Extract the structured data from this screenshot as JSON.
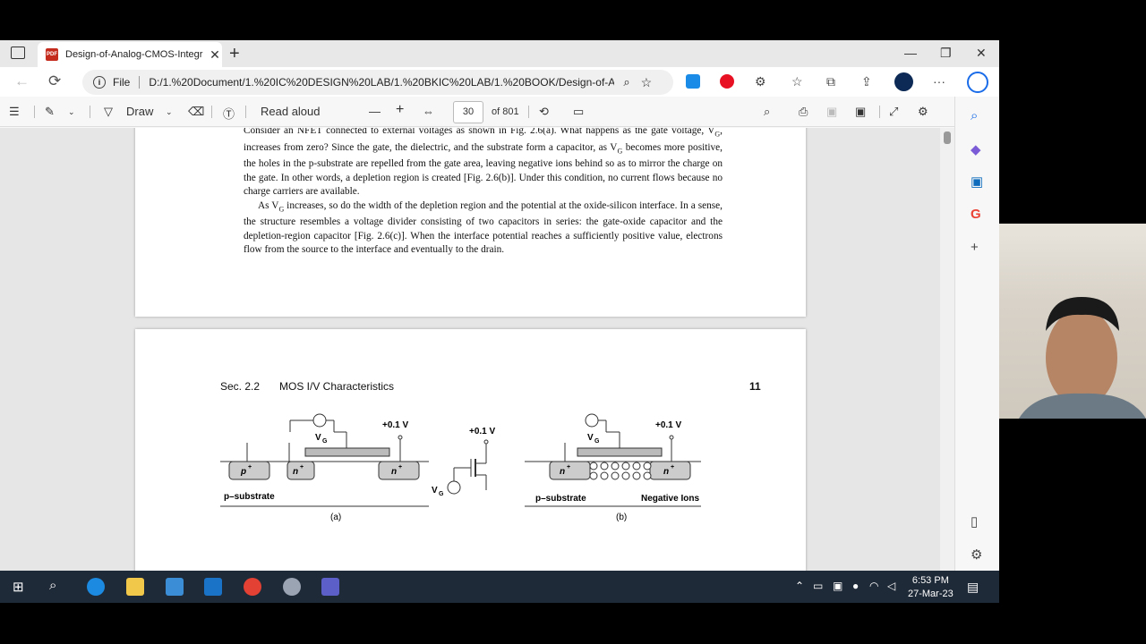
{
  "tab": {
    "title": "Design-of-Analog-CMOS-Integr",
    "close": "✕",
    "new": "+"
  },
  "window": {
    "min": "—",
    "max": "❐",
    "close": "✕"
  },
  "address": {
    "scheme": "File",
    "url": "D:/1.%20Document/1.%20IC%20DESIGN%20LAB/1.%20BKIC%20LAB/1.%20BOOK/Design-of-A..."
  },
  "pdf_toolbar": {
    "draw": "Draw",
    "read_aloud": "Read aloud",
    "page": "30",
    "of_pages": "of 801",
    "minus": "—",
    "plus": "+"
  },
  "page1": {
    "p1": "Consider an NFET connected to external voltages as shown in Fig. 2.6(a). What happens as the gate voltage, V",
    "p1b": "G",
    "p1c": ", increases from zero? Since the gate, the dielectric, and the substrate form a capacitor, as V",
    "p1d": "G",
    "p1e": " becomes more positive, the holes in the p-substrate are repelled from the gate area, leaving negative ions behind so as to mirror the charge on the gate. In other words, a depletion region is created [Fig. 2.6(b)]. Under this condition, no current flows because no charge carriers are available.",
    "p2a": "As V",
    "p2b": "G",
    "p2c": " increases, so do the width of the depletion region and the potential at the oxide-silicon interface. In a sense, the structure resembles a voltage divider consisting of two capacitors in series: the gate-oxide capacitor and the depletion-region capacitor [Fig. 2.6(c)]. When the interface potential reaches a sufficiently positive value, electrons flow from the source to the interface and eventually to the drain."
  },
  "page2": {
    "section": "Sec. 2.2",
    "heading": "MOS I/V Characteristics",
    "page_number": "11",
    "fig": {
      "vg": "V",
      "vg_sub": "G",
      "v01": "+0.1 V",
      "p_plus": "p",
      "n_plus": "n",
      "sup_plus": "+",
      "p_substrate": "p–substrate",
      "neg_ions": "Negative Ions",
      "cap_a": "(a)",
      "cap_b": "(b)"
    }
  },
  "clock": {
    "time": "6:53 PM",
    "date": "27-Mar-23"
  }
}
